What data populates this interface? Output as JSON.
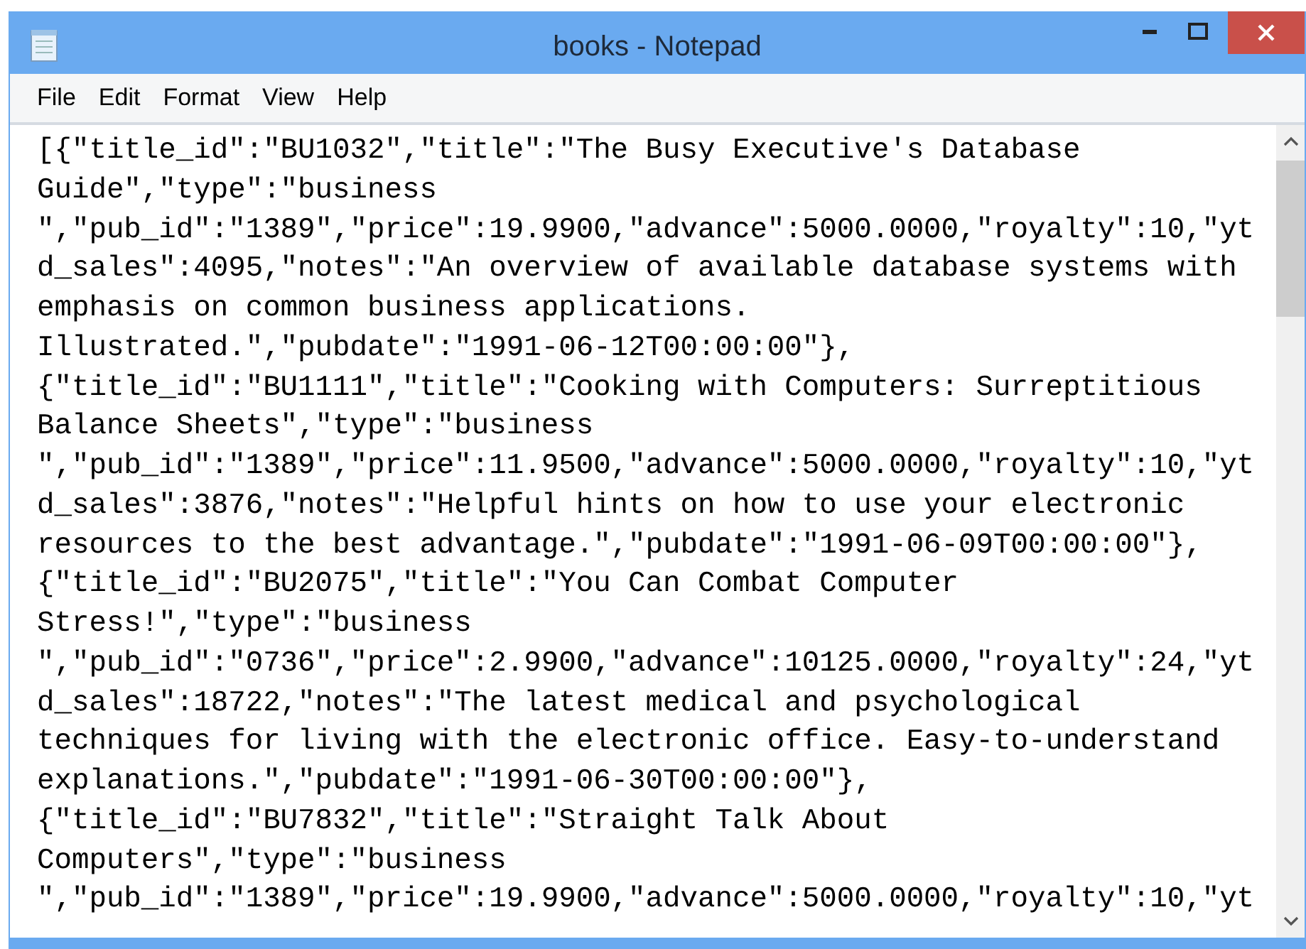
{
  "window": {
    "title": "books - Notepad"
  },
  "menu": [
    "File",
    "Edit",
    "Format",
    "View",
    "Help"
  ],
  "editor": {
    "lines": [
      "[{\"title_id\":\"BU1032\",\"title\":\"The Busy Executive's Database",
      "Guide\",\"type\":\"business",
      "\",\"pub_id\":\"1389\",\"price\":19.9900,\"advance\":5000.0000,\"royalty\":10,\"yt",
      "d_sales\":4095,\"notes\":\"An overview of available database systems with",
      "emphasis on common business applications.",
      "Illustrated.\",\"pubdate\":\"1991-06-12T00:00:00\"},",
      "{\"title_id\":\"BU1111\",\"title\":\"Cooking with Computers: Surreptitious",
      "Balance Sheets\",\"type\":\"business",
      "\",\"pub_id\":\"1389\",\"price\":11.9500,\"advance\":5000.0000,\"royalty\":10,\"yt",
      "d_sales\":3876,\"notes\":\"Helpful hints on how to use your electronic",
      "resources to the best advantage.\",\"pubdate\":\"1991-06-09T00:00:00\"},",
      "{\"title_id\":\"BU2075\",\"title\":\"You Can Combat Computer",
      "Stress!\",\"type\":\"business",
      "\",\"pub_id\":\"0736\",\"price\":2.9900,\"advance\":10125.0000,\"royalty\":24,\"yt",
      "d_sales\":18722,\"notes\":\"The latest medical and psychological",
      "techniques for living with the electronic office. Easy-to-understand",
      "explanations.\",\"pubdate\":\"1991-06-30T00:00:00\"},",
      "{\"title_id\":\"BU7832\",\"title\":\"Straight Talk About",
      "Computers\",\"type\":\"business",
      "\",\"pub_id\":\"1389\",\"price\":19.9900,\"advance\":5000.0000,\"royalty\":10,\"yt"
    ]
  }
}
